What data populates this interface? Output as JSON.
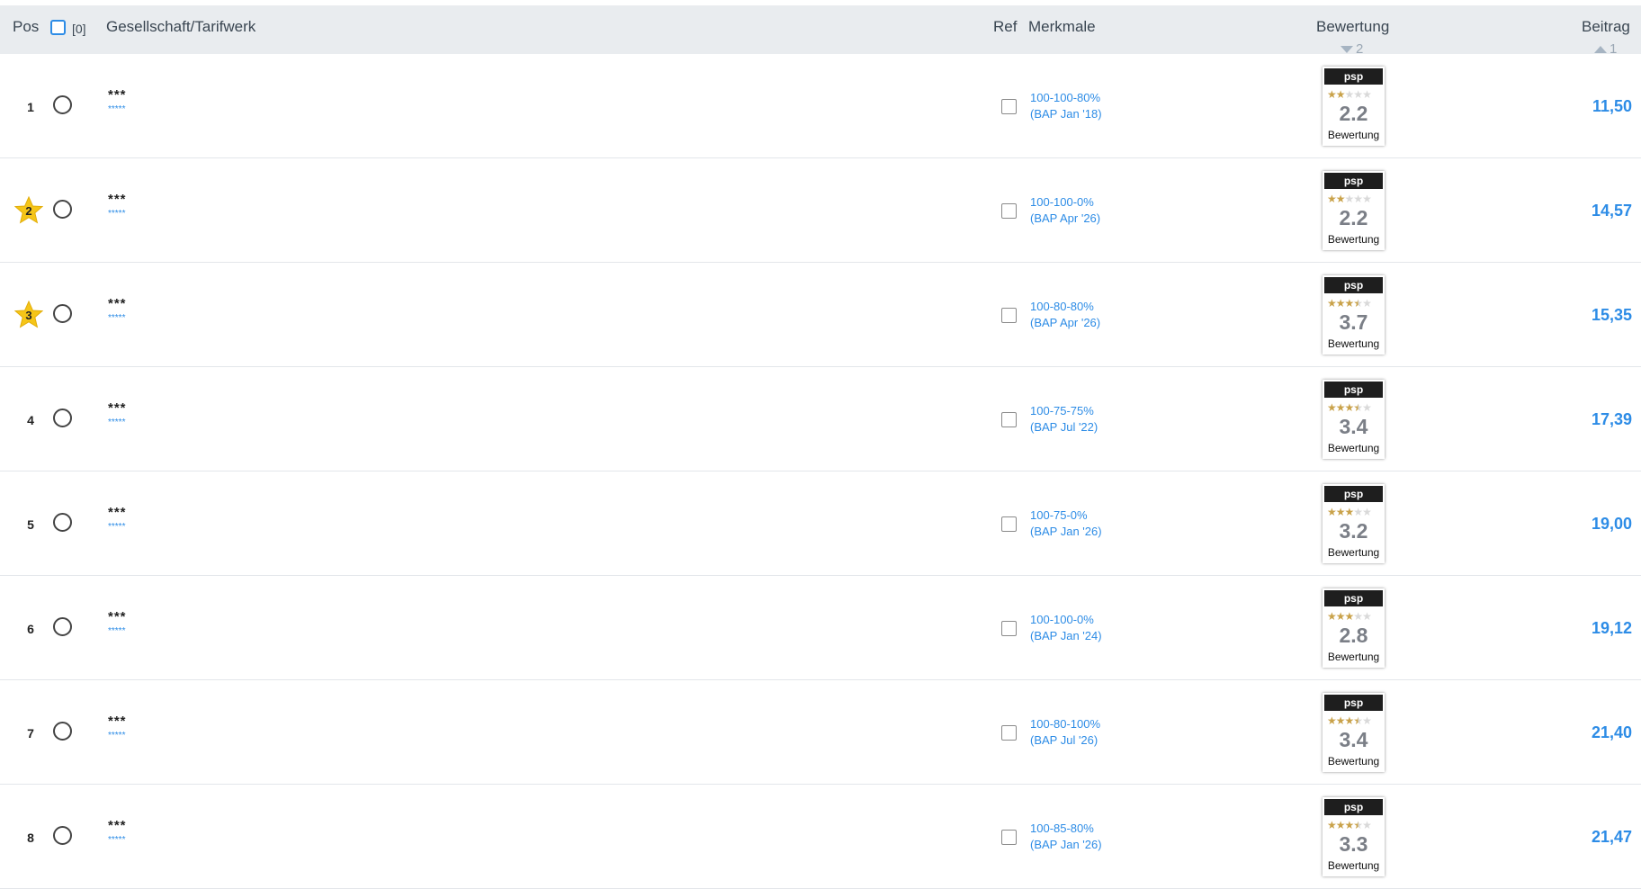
{
  "header": {
    "pos": "Pos",
    "selected_count": "[0]",
    "gesellschaft": "Gesellschaft/Tarifwerk",
    "ref": "Ref",
    "merkmale": "Merkmale",
    "bewertung": "Bewertung",
    "bewertung_sort": "2",
    "beitrag": "Beitrag",
    "beitrag_sort": "1"
  },
  "colors": {
    "accent": "#2d8ce6",
    "star_gold": "#f5c518",
    "rating_star": "#c9a24a"
  },
  "rows": [
    {
      "pos": "1",
      "star": false,
      "name": "***",
      "sub": "*****",
      "merkmal": "100-100-80%",
      "bap": "(BAP Jan '18)",
      "badge_brand": "psp",
      "stars": 2,
      "score": "2.2",
      "badge_label": "Bewertung",
      "price": "11,50"
    },
    {
      "pos": "2",
      "star": true,
      "name": "***",
      "sub": "*****",
      "merkmal": "100-100-0%",
      "bap": "(BAP Apr '26)",
      "badge_brand": "psp",
      "stars": 2,
      "score": "2.2",
      "badge_label": "Bewertung",
      "price": "14,57"
    },
    {
      "pos": "3",
      "star": true,
      "name": "***",
      "sub": "*****",
      "merkmal": "100-80-80%",
      "bap": "(BAP Apr '26)",
      "badge_brand": "psp",
      "stars": 3.5,
      "score": "3.7",
      "badge_label": "Bewertung",
      "price": "15,35"
    },
    {
      "pos": "4",
      "star": false,
      "name": "***",
      "sub": "*****",
      "merkmal": "100-75-75%",
      "bap": "(BAP Jul '22)",
      "badge_brand": "psp",
      "stars": 3.5,
      "score": "3.4",
      "badge_label": "Bewertung",
      "price": "17,39"
    },
    {
      "pos": "5",
      "star": false,
      "name": "***",
      "sub": "*****",
      "merkmal": "100-75-0%",
      "bap": "(BAP Jan '26)",
      "badge_brand": "psp",
      "stars": 3,
      "score": "3.2",
      "badge_label": "Bewertung",
      "price": "19,00"
    },
    {
      "pos": "6",
      "star": false,
      "name": "***",
      "sub": "*****",
      "merkmal": "100-100-0%",
      "bap": "(BAP Jan '24)",
      "badge_brand": "psp",
      "stars": 3,
      "score": "2.8",
      "badge_label": "Bewertung",
      "price": "19,12"
    },
    {
      "pos": "7",
      "star": false,
      "name": "***",
      "sub": "*****",
      "merkmal": "100-80-100%",
      "bap": "(BAP Jul '26)",
      "badge_brand": "psp",
      "stars": 3.5,
      "score": "3.4",
      "badge_label": "Bewertung",
      "price": "21,40"
    },
    {
      "pos": "8",
      "star": false,
      "name": "***",
      "sub": "*****",
      "merkmal": "100-85-80%",
      "bap": "(BAP Jan '26)",
      "badge_brand": "psp",
      "stars": 3.5,
      "score": "3.3",
      "badge_label": "Bewertung",
      "price": "21,47"
    }
  ]
}
